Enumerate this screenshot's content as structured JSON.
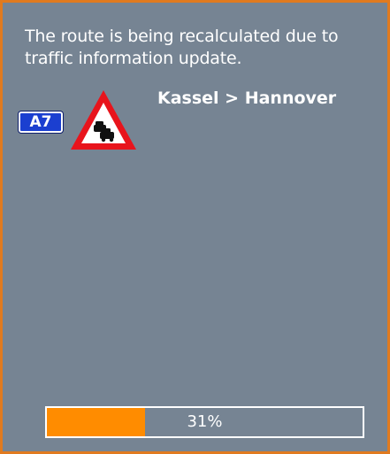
{
  "dialog": {
    "message": "The route is being recalculated due to traffic information update.",
    "route_label": "Kassel > Hannover",
    "road_badge": "A7",
    "warning_icon": "traffic-jam-warning-icon",
    "progress": {
      "percent": 31,
      "label": "31%"
    }
  },
  "colors": {
    "background": "#768493",
    "frame_border": "#e07a1f",
    "progress_fill": "#ff8c00",
    "road_badge_bg": "#1b3fd0",
    "sign_red": "#e8141c"
  }
}
